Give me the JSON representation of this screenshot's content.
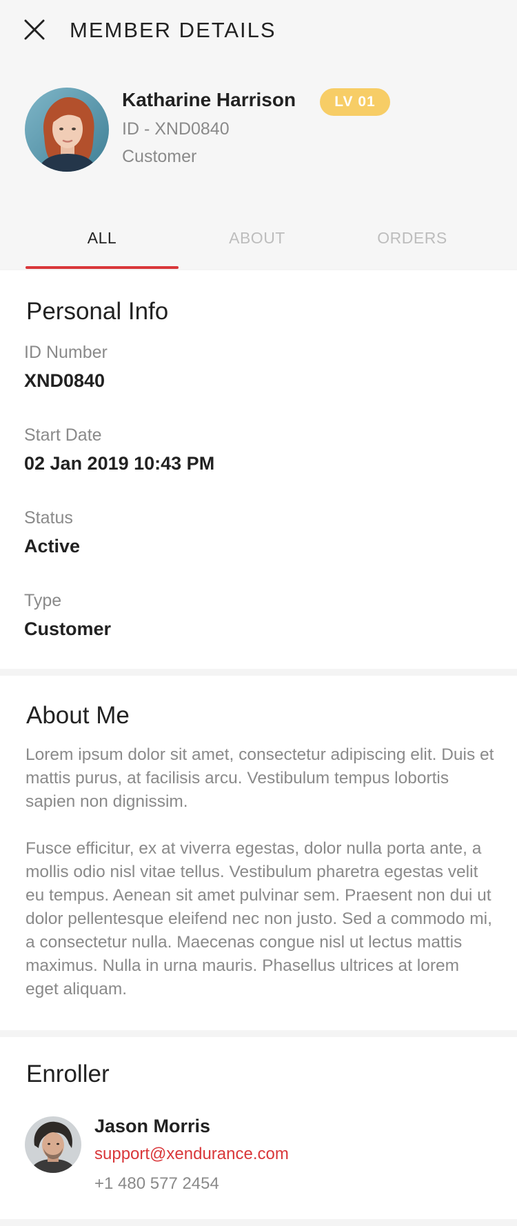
{
  "header": {
    "title": "MEMBER DETAILS",
    "close_icon": "close-icon"
  },
  "member": {
    "name": "Katharine Harrison",
    "level_badge": "LV 01",
    "id_line": "ID - XND0840",
    "role": "Customer"
  },
  "tabs": [
    {
      "label": "ALL",
      "active": true
    },
    {
      "label": "ABOUT",
      "active": false
    },
    {
      "label": "ORDERS",
      "active": false
    }
  ],
  "personal_info": {
    "title": "Personal Info",
    "fields": [
      {
        "label": "ID Number",
        "value": "XND0840"
      },
      {
        "label": "Start Date",
        "value": "02 Jan 2019 10:43 PM"
      },
      {
        "label": "Status",
        "value": "Active"
      },
      {
        "label": "Type",
        "value": "Customer"
      }
    ]
  },
  "about_me": {
    "title": "About Me",
    "paragraphs": [
      "Lorem ipsum dolor sit amet, consectetur adipiscing elit. Duis et mattis purus, at facilisis arcu. Vestibulum tempus lobortis sapien non dignissim.",
      "Fusce efficitur, ex at viverra egestas, dolor nulla porta ante, a mollis odio nisl vitae tellus. Vestibulum pharetra egestas velit eu tempus. Aenean sit amet pulvinar sem. Praesent non dui ut dolor pellentesque eleifend nec non justo. Sed a commodo mi, a consectetur nulla. Maecenas congue nisl ut lectus mattis maximus. Nulla in urna mauris. Phasellus ultrices at lorem eget aliquam."
    ]
  },
  "enroller": {
    "title": "Enroller",
    "name": "Jason Morris",
    "email": "support@xendurance.com",
    "phone": "+1 480 577 2454"
  },
  "colors": {
    "accent": "#d9373a",
    "badge": "#f7cd66",
    "muted_text": "#8a8a8a",
    "primary_text": "#222222",
    "header_bg": "#f6f6f6",
    "card_bg": "#ffffff"
  }
}
